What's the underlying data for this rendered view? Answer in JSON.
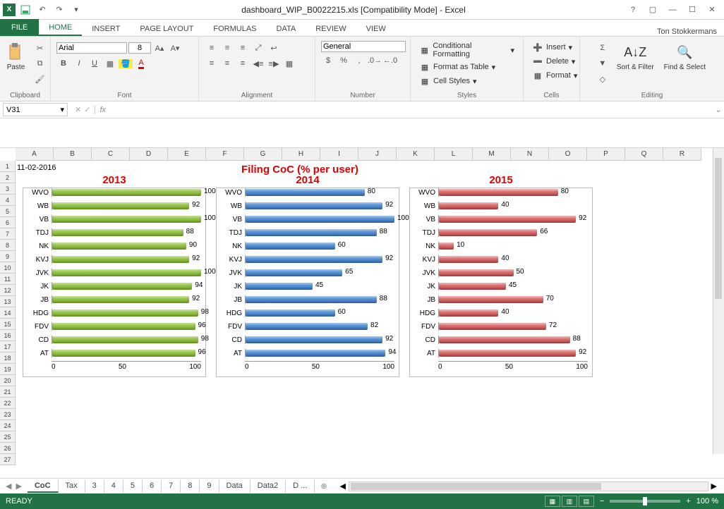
{
  "title_bar": {
    "filename": "dashboard_WIP_B0022215.xls  [Compatibility Mode] - Excel"
  },
  "user_name": "Ton Stokkermans",
  "ribbon_tabs": [
    "FILE",
    "HOME",
    "INSERT",
    "PAGE LAYOUT",
    "FORMULAS",
    "DATA",
    "REVIEW",
    "VIEW"
  ],
  "active_tab": "HOME",
  "ribbon": {
    "clipboard_label": "Clipboard",
    "paste_label": "Paste",
    "font_label": "Font",
    "font_name": "Arial",
    "font_size": "8",
    "alignment_label": "Alignment",
    "number_label": "Number",
    "number_format": "General",
    "styles_label": "Styles",
    "cond_fmt": "Conditional Formatting",
    "fmt_table": "Format as Table",
    "cell_styles": "Cell Styles",
    "cells_label": "Cells",
    "insert": "Insert",
    "delete": "Delete",
    "format": "Format",
    "editing_label": "Editing",
    "sort_filter": "Sort & Filter",
    "find_select": "Find & Select"
  },
  "name_box": "V31",
  "worksheet": {
    "date": "11-02-2016",
    "title": "Filing CoC    (% per user)",
    "col_headers": [
      "A",
      "B",
      "C",
      "D",
      "E",
      "F",
      "G",
      "H",
      "I",
      "J",
      "K",
      "L",
      "M",
      "N",
      "O",
      "P",
      "Q",
      "R"
    ],
    "row_headers": [
      "1",
      "2",
      "3",
      "4",
      "5",
      "6",
      "7",
      "8",
      "9",
      "10",
      "11",
      "12",
      "13",
      "14",
      "15",
      "16",
      "17",
      "18",
      "19",
      "20",
      "21",
      "22",
      "23",
      "24",
      "25",
      "26",
      "27"
    ],
    "x_ticks": [
      "0",
      "50",
      "100"
    ]
  },
  "chart_data": [
    {
      "title": "2013",
      "type": "bar",
      "color": "green",
      "series": [
        {
          "name": "WVO",
          "value": 100
        },
        {
          "name": "WB",
          "value": 92
        },
        {
          "name": "VB",
          "value": 100
        },
        {
          "name": "TDJ",
          "value": 88
        },
        {
          "name": "NK",
          "value": 90
        },
        {
          "name": "KVJ",
          "value": 92
        },
        {
          "name": "JVK",
          "value": 100
        },
        {
          "name": "JK",
          "value": 94
        },
        {
          "name": "JB",
          "value": 92
        },
        {
          "name": "HDG",
          "value": 98
        },
        {
          "name": "FDV",
          "value": 96
        },
        {
          "name": "CD",
          "value": 98
        },
        {
          "name": "AT",
          "value": 96
        }
      ],
      "xlim": [
        0,
        100
      ]
    },
    {
      "title": "2014",
      "type": "bar",
      "color": "blue",
      "series": [
        {
          "name": "WVO",
          "value": 80
        },
        {
          "name": "WB",
          "value": 92
        },
        {
          "name": "VB",
          "value": 100
        },
        {
          "name": "TDJ",
          "value": 88
        },
        {
          "name": "NK",
          "value": 60
        },
        {
          "name": "KVJ",
          "value": 92
        },
        {
          "name": "JVK",
          "value": 65
        },
        {
          "name": "JK",
          "value": 45
        },
        {
          "name": "JB",
          "value": 88
        },
        {
          "name": "HDG",
          "value": 60
        },
        {
          "name": "FDV",
          "value": 82
        },
        {
          "name": "CD",
          "value": 92
        },
        {
          "name": "AT",
          "value": 94
        }
      ],
      "xlim": [
        0,
        100
      ]
    },
    {
      "title": "2015",
      "type": "bar",
      "color": "red",
      "series": [
        {
          "name": "WVO",
          "value": 80
        },
        {
          "name": "WB",
          "value": 40
        },
        {
          "name": "VB",
          "value": 92
        },
        {
          "name": "TDJ",
          "value": 66
        },
        {
          "name": "NK",
          "value": 10
        },
        {
          "name": "KVJ",
          "value": 40
        },
        {
          "name": "JVK",
          "value": 50
        },
        {
          "name": "JK",
          "value": 45
        },
        {
          "name": "JB",
          "value": 70
        },
        {
          "name": "HDG",
          "value": 40
        },
        {
          "name": "FDV",
          "value": 72
        },
        {
          "name": "CD",
          "value": 88
        },
        {
          "name": "AT",
          "value": 92
        }
      ],
      "xlim": [
        0,
        100
      ]
    }
  ],
  "sheet_tabs": [
    "CoC",
    "Tax",
    "3",
    "4",
    "5",
    "6",
    "7",
    "8",
    "9",
    "Data",
    "Data2",
    "D ..."
  ],
  "active_sheet": "CoC",
  "status": {
    "ready": "READY",
    "zoom": "100 %"
  }
}
